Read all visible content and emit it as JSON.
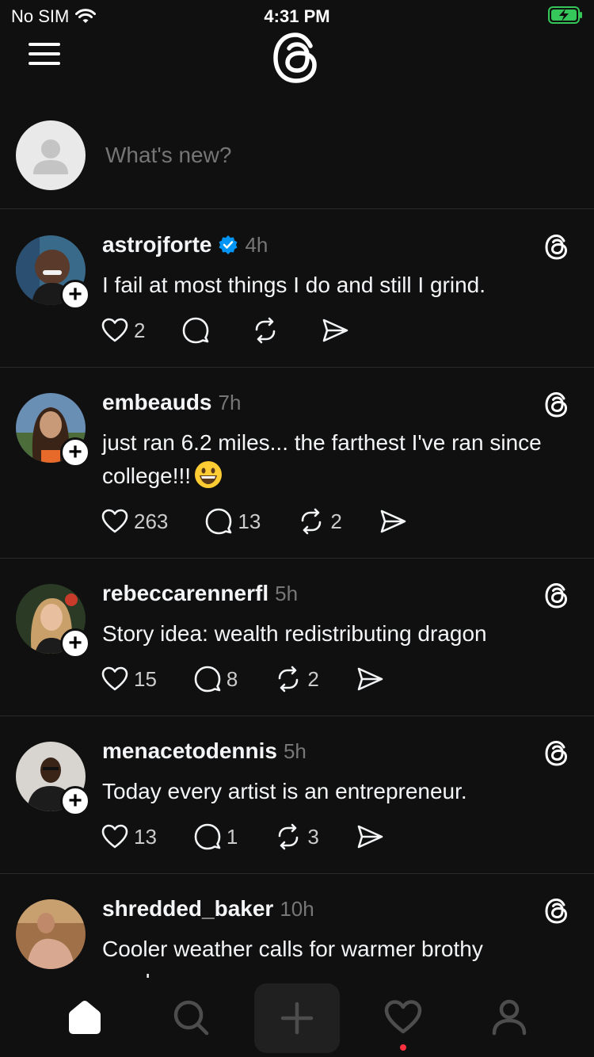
{
  "status_bar": {
    "carrier": "No SIM",
    "time": "4:31 PM",
    "battery_color": "#35c759"
  },
  "header": {
    "logo": "threads-logo",
    "menu": "hamburger-menu-icon"
  },
  "composer": {
    "placeholder": "What's new?"
  },
  "posts": [
    {
      "username": "astrojforte",
      "verified": true,
      "time": "4h",
      "text": "I fail at most things I do and still I grind.",
      "likes": "2",
      "comments": "",
      "reposts": "",
      "avatar_colors": [
        "#3a6a8a",
        "#5a3a2a"
      ]
    },
    {
      "username": "embeauds",
      "verified": false,
      "time": "7h",
      "text": "just ran 6.2 miles... the farthest I've ran since college!!!",
      "likes": "263",
      "comments": "13",
      "reposts": "2",
      "avatar_colors": [
        "#6a8fb5",
        "#3a2418"
      ]
    },
    {
      "username": "rebeccarennerfl",
      "verified": false,
      "time": "5h",
      "text": "Story idea: wealth redistributing dragon",
      "likes": "15",
      "comments": "8",
      "reposts": "2",
      "avatar_colors": [
        "#5a3a2a",
        "#c9a06a"
      ]
    },
    {
      "username": "menacetodennis",
      "verified": false,
      "time": "5h",
      "text": "Today every artist is an entrepreneur.",
      "likes": "13",
      "comments": "1",
      "reposts": "3",
      "avatar_colors": [
        "#d8d4cf",
        "#1c1c1c"
      ]
    },
    {
      "username": "shredded_baker",
      "verified": false,
      "time": "10h",
      "text": "Cooler weather calls for warmer brothy meals",
      "likes": "",
      "comments": "",
      "reposts": "",
      "avatar_colors": [
        "#a07048",
        "#d8a890"
      ]
    }
  ],
  "tab_bar": {
    "tabs": [
      "home-icon",
      "search-icon",
      "compose-icon",
      "activity-icon",
      "profile-icon"
    ],
    "notification_color": "#ff3040"
  }
}
